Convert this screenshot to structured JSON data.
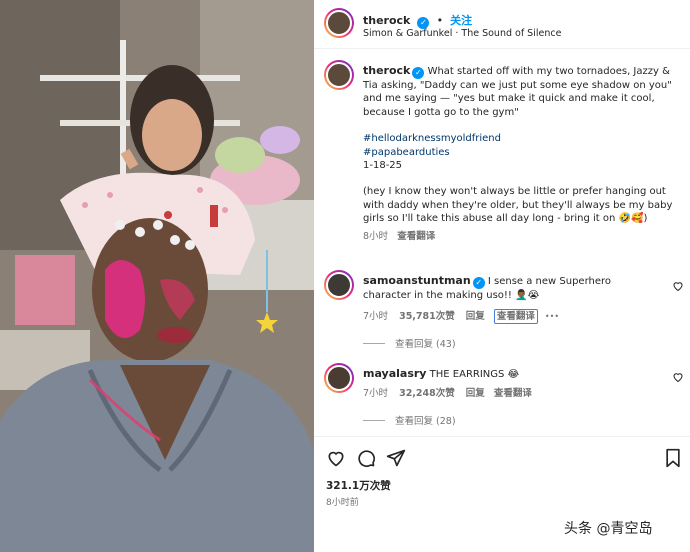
{
  "header": {
    "username": "therock",
    "follow_label": "关注",
    "audio": "Simon & Garfunkel · The Sound of Silence"
  },
  "caption": {
    "username": "therock",
    "text1": "What started off with my two tornadoes, Jazzy & Tia asking, \"Daddy can we just put some eye shadow on you\" and me saying — \"yes but make it quick and make it cool, because I gotta go to the gym\"",
    "hashtag1": "#hellodarknessmyoldfriend",
    "hashtag2": "#papabearduties",
    "date": "1-18-25",
    "text2": "(hey I know they won't always be little or prefer hanging out with daddy when they're older, but they'll always be my baby girls so I'll take this abuse all day long - bring it on 🤣🥰)",
    "time": "8小时",
    "translate": "查看翻译"
  },
  "comments": [
    {
      "username": "samoanstuntman",
      "text": "I sense a new Superhero character in the making uso!! 🤦🏾‍♂️😭",
      "time": "7小时",
      "likes": "35,781次赞",
      "reply": "回复",
      "translate": "查看翻译",
      "more": "•••",
      "view_replies": "查看回复 (43)"
    },
    {
      "username": "mayalasry",
      "text": "THE EARRINGS 😂",
      "time": "7小时",
      "likes": "32,248次赞",
      "reply": "回复",
      "translate": "查看翻译",
      "view_replies": "查看回复 (28)"
    }
  ],
  "footer": {
    "views": "321.1万次赞",
    "posted": "8小时前"
  },
  "watermark": "头条 @青空岛",
  "icons": {
    "like": "heart-icon",
    "comment": "comment-icon",
    "share": "share-icon",
    "save": "bookmark-icon"
  },
  "colors": {
    "verified": "#0095f6",
    "link": "#00376b",
    "follow": "#0095f6",
    "muted": "#737373"
  }
}
